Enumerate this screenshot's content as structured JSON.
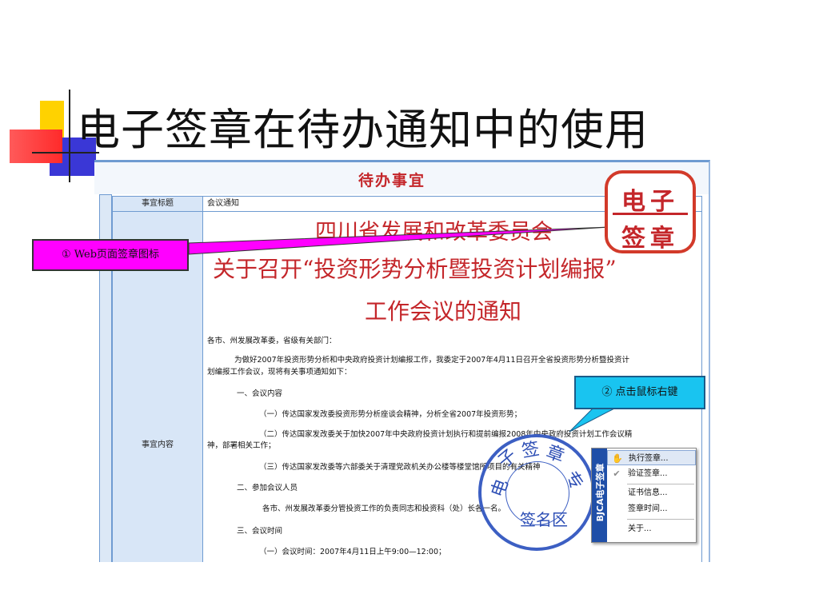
{
  "slide": {
    "title": "电子签章在待办通知中的使用"
  },
  "screenshot": {
    "header": "待办事宜",
    "fields": [
      {
        "label": "事宜标题",
        "value": "会议通知"
      },
      {
        "label": "事宜内容"
      }
    ],
    "doc_title": [
      "四川省发展和改革委员会",
      "关于召开“投资形势分析暨投资计划编报”",
      "工作会议的通知"
    ],
    "body": [
      "各市、州发展改革委，省级有关部门：",
      "为做好2007年投资形势分析和中央政府投资计划编报工作，我委定于2007年4月11日召开全省投资形势分析暨投资计",
      "划编报工作会议，现将有关事项通知如下：",
      "一、会议内容",
      "（一）传达国家发改委投资形势分析座谈会精神，分析全省2007年投资形势；",
      "（二）传达国家发改委关于加快2007年中央政府投资计划执行和提前编报2008年中央政府投资计划工作会议精",
      "神，部署相关工作；",
      "（三）传达国家发改委等六部委关于清理党政机关办公楼等楼堂馆所项目的有关精神",
      "二、参加会议人员",
      "各市、州发展改革委分管投资工作的负责同志和投资科（处）长各一名。",
      "三、会议时间",
      "（一）会议时间：2007年4月11日上午9:00—12:00；"
    ],
    "seal_button": {
      "line1": "电子",
      "line2": "签章"
    },
    "stamp": {
      "chars": [
        "电",
        "子",
        "签",
        "章",
        "专"
      ],
      "label": "签名区"
    },
    "context_menu": {
      "side_label": "BJCA电子签章",
      "items": [
        {
          "icon": "stamp-icon",
          "label": "执行签章..."
        },
        {
          "icon": "check-icon",
          "label": "验证签章..."
        },
        {
          "label": "证书信息..."
        },
        {
          "label": "签章时间..."
        },
        {
          "label": "关于..."
        }
      ]
    }
  },
  "callouts": {
    "c1": "① Web页面签章图标",
    "c2": "② 点击鼠标右键"
  },
  "colors": {
    "accent_red": "#c4262a",
    "table_border": "#6f9bd1",
    "label_bg": "#d8e6f7",
    "callout1": "#ff00ff",
    "callout2": "#19c4f0",
    "stamp_blue": "#2e4fb5"
  }
}
